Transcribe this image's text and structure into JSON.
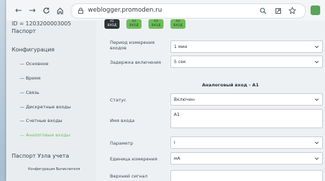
{
  "browser": {
    "url": "weblogger.promoden.ru",
    "nav_back": "←",
    "nav_forward": "→",
    "nav_reload": "C",
    "nav_home": "⌂"
  },
  "sidebar": {
    "device_id": "ID = 1203200003005",
    "passport": "Паспорт",
    "config_title": "Конфигурация",
    "items": [
      {
        "label": "— Основное"
      },
      {
        "label": "— Время"
      },
      {
        "label": "— Связь"
      },
      {
        "label": "— Дискретные входы"
      },
      {
        "label": "— Счетные входы"
      },
      {
        "label": "— Аналоговые входы"
      }
    ],
    "node_passport": "Паспорт Узла учета",
    "node_sub": "Конфигурация Вычислителя"
  },
  "channels": [
    {
      "id": "A1",
      "sub": "ВХОД"
    },
    {
      "id": "A2",
      "sub": "ВХОД"
    },
    {
      "id": "A3",
      "sub": "ВХОД"
    },
    {
      "id": "A4",
      "sub": "ВХОД"
    }
  ],
  "form": {
    "period_label": "Период измерения входов",
    "period_value": "1 мин",
    "delay_label": "Задержка включения",
    "delay_value": "5 сек",
    "section_title": "Аналоговый вход - А1",
    "status_label": "Статус",
    "status_value": "Включен",
    "name_label": "Имя входа",
    "name_value": "А1",
    "param_label": "Параметр",
    "param_value": "I",
    "unit_label": "Единица измерения",
    "unit_value": "мА",
    "lower_label": "Верхний сигнал"
  }
}
